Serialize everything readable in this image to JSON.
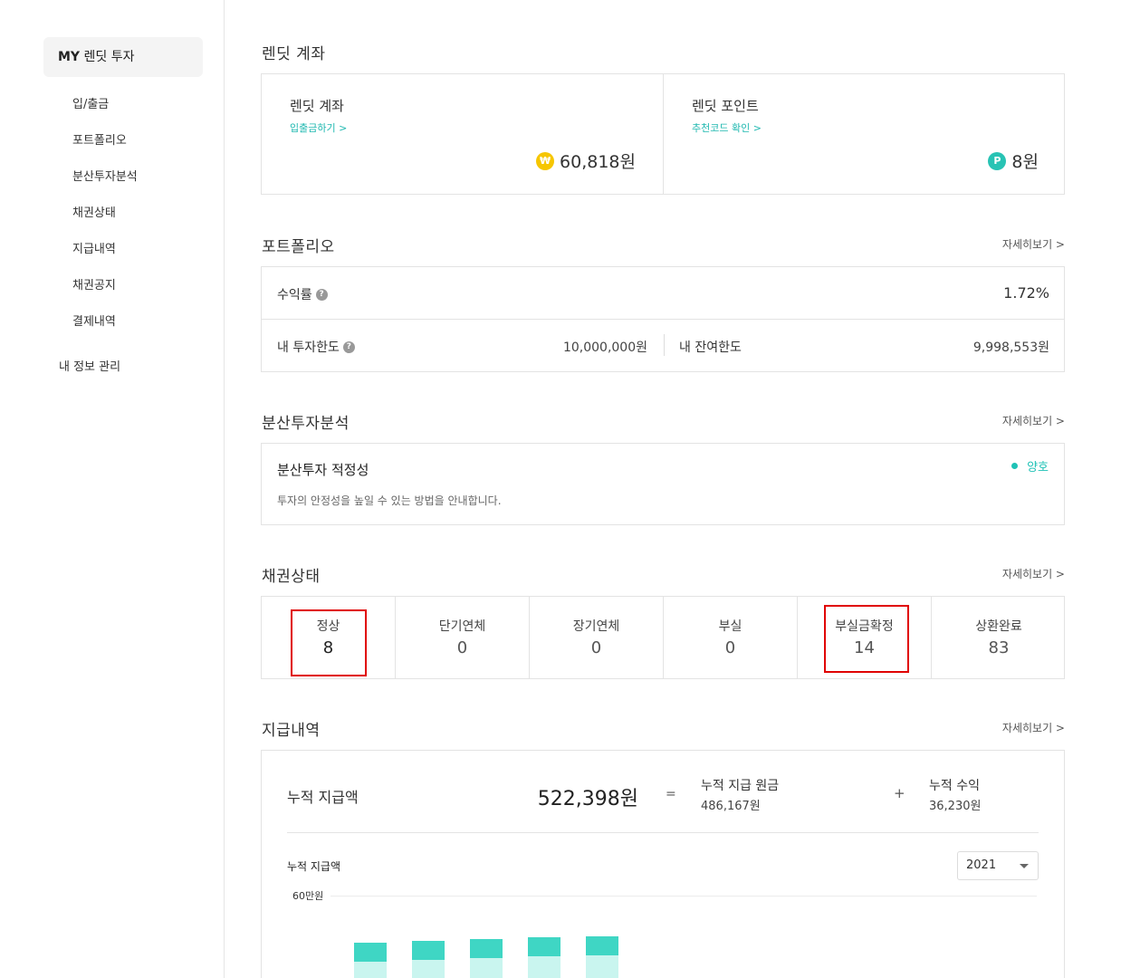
{
  "sidebar": {
    "head_prefix": "MY",
    "head_rest": " 렌딧 투자",
    "items": [
      "입/출금",
      "포트폴리오",
      "분산투자분석",
      "채권상태",
      "지급내역",
      "채권공지",
      "결제내역"
    ],
    "profile": "내 정보 관리"
  },
  "account": {
    "section_title": "렌딧 계좌",
    "lendit_account": {
      "title": "렌딧 계좌",
      "link": "입출금하기 >",
      "icon": "won-coin-icon",
      "coin_glyph": "₩",
      "amount": "60,818원"
    },
    "lendit_point": {
      "title": "렌딧 포인트",
      "link": "추천코드 확인 >",
      "icon": "point-coin-icon",
      "coin_glyph": "P",
      "amount": "8원"
    }
  },
  "portfolio": {
    "section_title": "포트폴리오",
    "more": "자세히보기 >",
    "yield_label": "수익률",
    "yield_value": "1.72%",
    "limit_label": "내 투자한도",
    "limit_value": "10,000,000원",
    "remaining_label": "내 잔여한도",
    "remaining_value": "9,998,553원"
  },
  "diversify": {
    "section_title": "분산투자분석",
    "more": "자세히보기 >",
    "title": "분산투자 적정성",
    "desc": "투자의 안정성을 높일 수 있는 방법을 안내합니다.",
    "status": "양호",
    "status_color": "#1fc2b6"
  },
  "bonds": {
    "section_title": "채권상태",
    "more": "자세히보기 >",
    "cells": [
      {
        "label": "정상",
        "value": "8"
      },
      {
        "label": "단기연체",
        "value": "0"
      },
      {
        "label": "장기연체",
        "value": "0"
      },
      {
        "label": "부실",
        "value": "0"
      },
      {
        "label": "부실금확정",
        "value": "14"
      },
      {
        "label": "상환완료",
        "value": "83"
      }
    ]
  },
  "payments": {
    "section_title": "지급내역",
    "more": "자세히보기 >",
    "total_label": "누적 지급액",
    "total_value": "522,398원",
    "eq": "=",
    "principal_label": "누적 지급 원금",
    "principal_value": "486,167원",
    "plus": "+",
    "profit_label": "누적 수익",
    "profit_value": "36,230원",
    "chart_title": "누적 지급액",
    "year": "2021",
    "y_tick": "60만원"
  },
  "colors": {
    "accent": "#1fb8b0",
    "bar_top": "#3fd6c4",
    "bar_bottom": "#c9f5ef",
    "highlight": "#e00000"
  }
}
